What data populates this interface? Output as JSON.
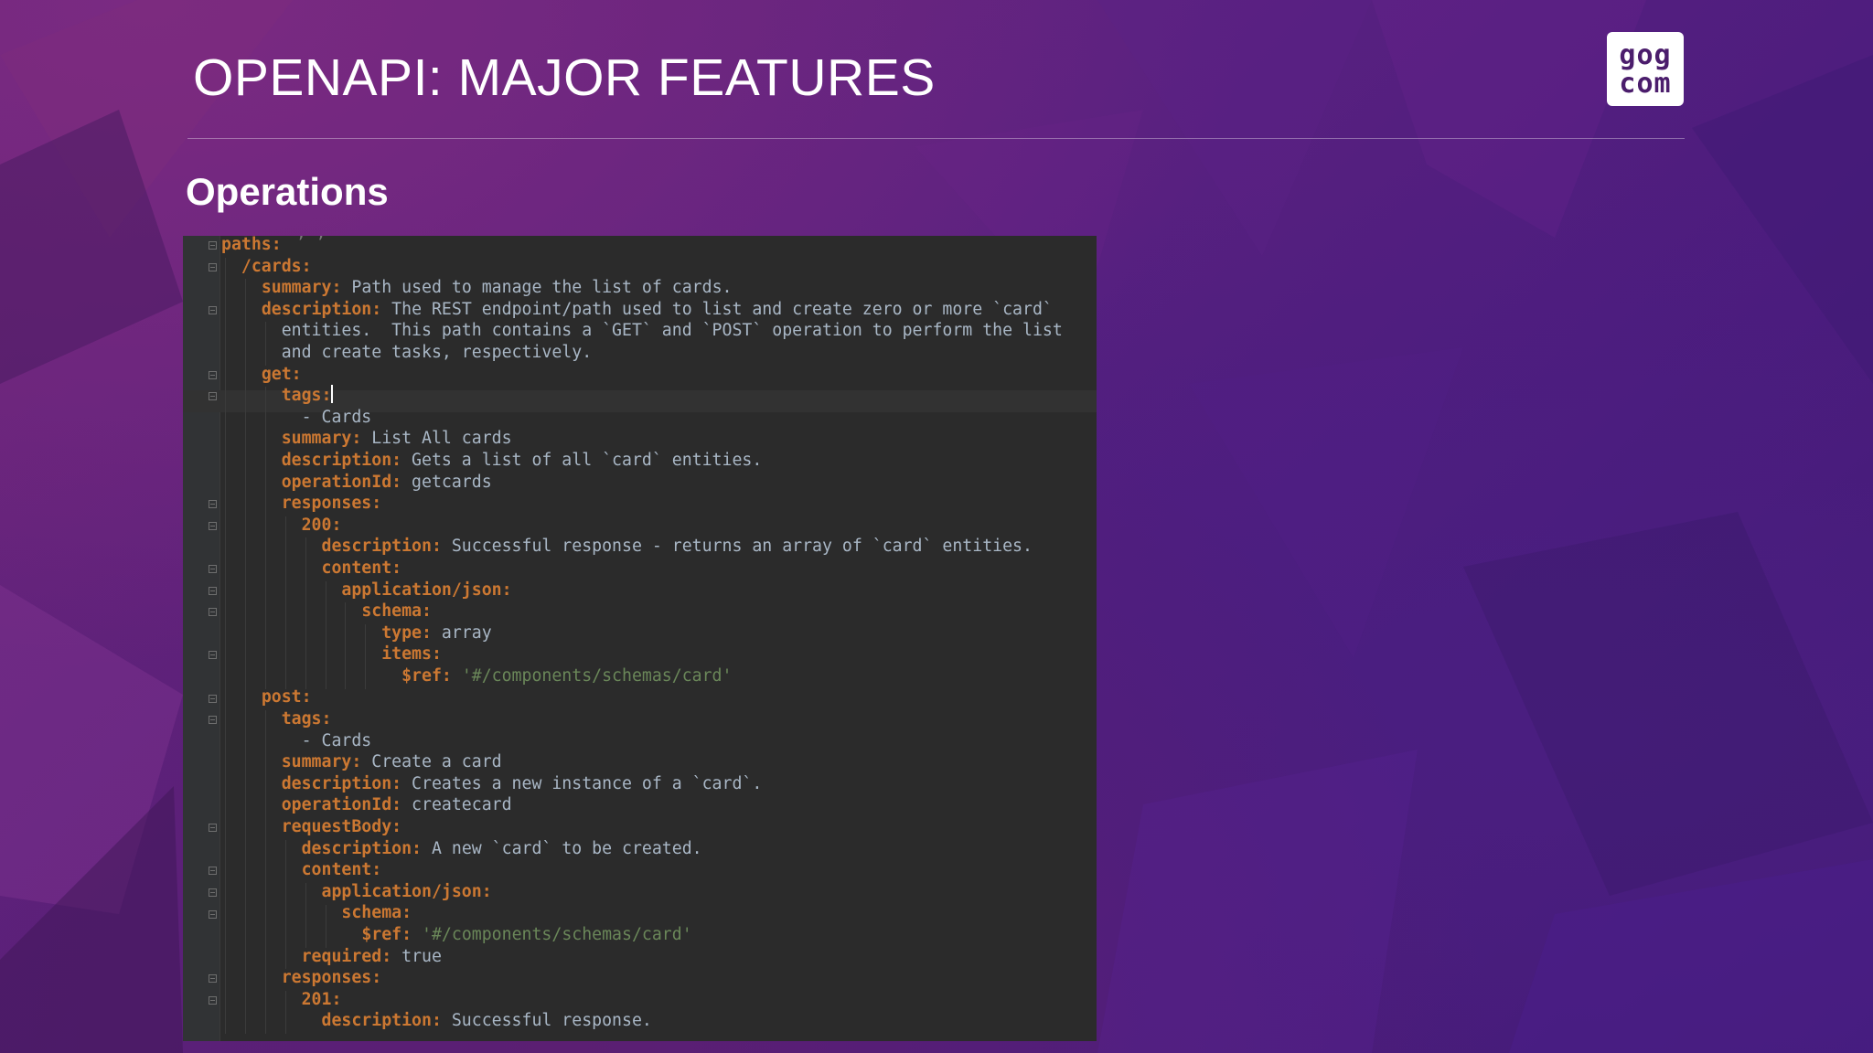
{
  "slide": {
    "title": "OPENAPI: MAJOR FEATURES",
    "subtitle": "Operations",
    "logo": {
      "line1": "gog",
      "line2": "com"
    }
  },
  "colors": {
    "title_text": "#ffffff",
    "editor_bg": "#2b2b2b",
    "yaml_key": "#cc7832",
    "yaml_value": "#a9b7c6",
    "yaml_string": "#6a8759"
  },
  "editor": {
    "current_line_index": 7,
    "lines": [
      {
        "indent": "",
        "key": "paths:",
        "value": "",
        "string": ""
      },
      {
        "indent": "  ",
        "key": "/cards:",
        "value": "",
        "string": ""
      },
      {
        "indent": "    ",
        "key": "summary:",
        "value": " Path used to manage the list of cards.",
        "string": ""
      },
      {
        "indent": "    ",
        "key": "description:",
        "value": " The REST endpoint/path used to list and create zero or more `card`",
        "string": ""
      },
      {
        "indent": "      ",
        "key": "",
        "value": "entities.  This path contains a `GET` and `POST` operation to perform the list",
        "string": ""
      },
      {
        "indent": "      ",
        "key": "",
        "value": "and create tasks, respectively.",
        "string": ""
      },
      {
        "indent": "    ",
        "key": "get:",
        "value": "",
        "string": ""
      },
      {
        "indent": "      ",
        "key": "tags:",
        "value": "",
        "string": "",
        "caret": true
      },
      {
        "indent": "        ",
        "key": "",
        "value": "- Cards",
        "string": ""
      },
      {
        "indent": "      ",
        "key": "summary:",
        "value": " List All cards",
        "string": ""
      },
      {
        "indent": "      ",
        "key": "description:",
        "value": " Gets a list of all `card` entities.",
        "string": ""
      },
      {
        "indent": "      ",
        "key": "operationId:",
        "value": " getcards",
        "string": ""
      },
      {
        "indent": "      ",
        "key": "responses:",
        "value": "",
        "string": ""
      },
      {
        "indent": "        ",
        "key": "200:",
        "value": "",
        "string": ""
      },
      {
        "indent": "          ",
        "key": "description:",
        "value": " Successful response - returns an array of `card` entities.",
        "string": ""
      },
      {
        "indent": "          ",
        "key": "content:",
        "value": "",
        "string": ""
      },
      {
        "indent": "            ",
        "key": "application/json:",
        "value": "",
        "string": ""
      },
      {
        "indent": "              ",
        "key": "schema:",
        "value": "",
        "string": ""
      },
      {
        "indent": "                ",
        "key": "type:",
        "value": " array",
        "string": ""
      },
      {
        "indent": "                ",
        "key": "items:",
        "value": "",
        "string": ""
      },
      {
        "indent": "                  ",
        "key": "$ref:",
        "value": " ",
        "string": "'#/components/schemas/card'"
      },
      {
        "indent": "    ",
        "key": "post:",
        "value": "",
        "string": ""
      },
      {
        "indent": "      ",
        "key": "tags:",
        "value": "",
        "string": ""
      },
      {
        "indent": "        ",
        "key": "",
        "value": "- Cards",
        "string": ""
      },
      {
        "indent": "      ",
        "key": "summary:",
        "value": " Create a card",
        "string": ""
      },
      {
        "indent": "      ",
        "key": "description:",
        "value": " Creates a new instance of a `card`.",
        "string": ""
      },
      {
        "indent": "      ",
        "key": "operationId:",
        "value": " createcard",
        "string": ""
      },
      {
        "indent": "      ",
        "key": "requestBody:",
        "value": "",
        "string": ""
      },
      {
        "indent": "        ",
        "key": "description:",
        "value": " A new `card` to be created.",
        "string": ""
      },
      {
        "indent": "        ",
        "key": "content:",
        "value": "",
        "string": ""
      },
      {
        "indent": "          ",
        "key": "application/json:",
        "value": "",
        "string": ""
      },
      {
        "indent": "            ",
        "key": "schema:",
        "value": "",
        "string": ""
      },
      {
        "indent": "              ",
        "key": "$ref:",
        "value": " ",
        "string": "'#/components/schemas/card'"
      },
      {
        "indent": "        ",
        "key": "required:",
        "value": " true",
        "string": ""
      },
      {
        "indent": "      ",
        "key": "responses:",
        "value": "",
        "string": ""
      },
      {
        "indent": "        ",
        "key": "201:",
        "value": "",
        "string": ""
      },
      {
        "indent": "          ",
        "key": "description:",
        "value": " Successful response.",
        "string": ""
      }
    ]
  }
}
